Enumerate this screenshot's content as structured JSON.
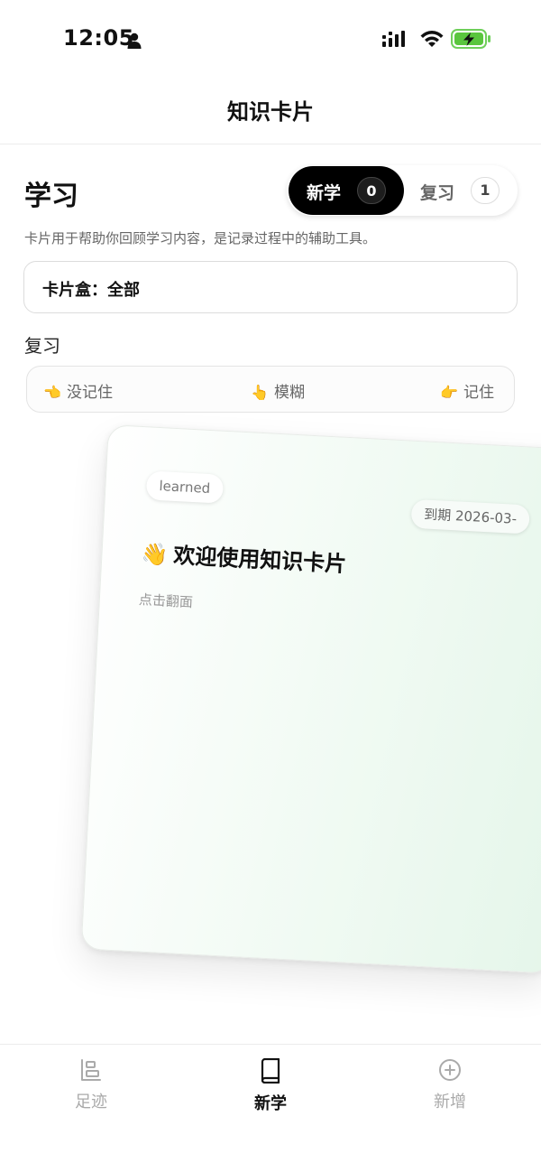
{
  "status_bar": {
    "time": "12:05"
  },
  "nav": {
    "title": "知识卡片"
  },
  "header": {
    "title": "学习",
    "segments": {
      "new": {
        "label": "新学",
        "count": "0"
      },
      "review": {
        "label": "复习",
        "count": "1"
      }
    }
  },
  "description": "卡片用于帮助你回顾学习内容，是记录过程中的辅助工具。",
  "deck_selector": {
    "label": "卡片盒：全部"
  },
  "review_section": {
    "label": "复习",
    "ratings": [
      {
        "emoji": "👈",
        "label": "没记住"
      },
      {
        "emoji": "👆",
        "label": "模糊"
      },
      {
        "emoji": "👉",
        "label": "记住"
      }
    ]
  },
  "card": {
    "status_tag": "learned",
    "due": "到期 2026-03-",
    "emoji": "👋",
    "title": "欢迎使用知识卡片",
    "hint": "点击翻面"
  },
  "tabs": [
    {
      "label": "足迹",
      "icon": "footprints-icon",
      "active": false
    },
    {
      "label": "新学",
      "icon": "book-icon",
      "active": true
    },
    {
      "label": "新增",
      "icon": "add-circle-icon",
      "active": false
    }
  ],
  "colors": {
    "accent": "#000000",
    "card_gradient_end": "#e5f6ea",
    "inactive_tab": "#aaaaaa"
  }
}
